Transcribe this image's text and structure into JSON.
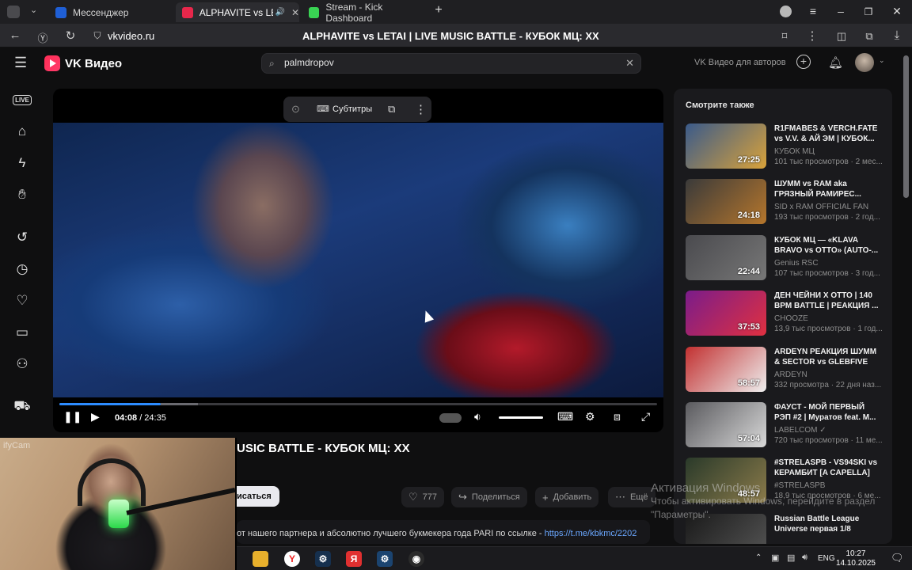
{
  "tabs": [
    {
      "label": "Мессенджер",
      "color": "#1f5fd6"
    },
    {
      "label": "ALPHAVITE vs LETA",
      "color": "#e8274b",
      "active": true
    },
    {
      "label": "Stream - Kick Dashboard",
      "color": "#39d353"
    }
  ],
  "address": {
    "url": "vkvideo.ru",
    "title": "ALPHAVITE vs LETAI | LIVE MUSIC BATTLE - КУБОК МЦ: XX"
  },
  "header": {
    "logo": "VK Видео",
    "search_value": "palmdropov",
    "authors_link": "VK Видео для авторов"
  },
  "rail_icons": [
    "live-icon",
    "home-icon",
    "shorts-icon",
    "hand-icon",
    "history-icon",
    "clock-icon",
    "heart-icon",
    "tv-icon",
    "subscriptions-icon",
    "cart-icon"
  ],
  "rail_live_label": "LIVE",
  "player": {
    "subtitles_label": "Субтитры",
    "time_current": "04:08",
    "time_total": " / 24:35",
    "progress": 0.169,
    "buffered": 0.232,
    "volume": 1.0
  },
  "video": {
    "title": "USIC BATTLE - КУБОК МЦ: XX",
    "subscribe_label": "исаться",
    "likes": "777",
    "share_label": "Поделиться",
    "add_label": "Добавить",
    "more_label": "Ещё",
    "description": "от нашего партнера и абсолютно лучшего букмекера года PARI по ссылке - ",
    "description_link": "https://t.me/kbkmc/2202"
  },
  "related": {
    "heading": "Смотрите также",
    "items": [
      {
        "title": "R1FMABES & VERCH.FATE vs V.V. & АЙ ЭМ | КУБОК...",
        "channel": "КУБОК МЦ",
        "meta": "101 тыс просмотров · 2 мес...",
        "duration": "27:25",
        "c1": "#3a5a8a",
        "c2": "#d9a23a"
      },
      {
        "title": "ШУММ vs RAM aka ГРЯЗНЫЙ РАМИРЕС...",
        "channel": "SID x RAM OFFICIAL FAN",
        "meta": "193 тыс просмотров · 2 год...",
        "duration": "24:18",
        "c1": "#3a3a3a",
        "c2": "#b5762c"
      },
      {
        "title": "КУБОК МЦ — «KLAVA BRAVO vs OTTO» (AUTO-...",
        "channel": "Genius RSC",
        "meta": "107 тыс просмотров · 3 год...",
        "duration": "22:44",
        "c1": "#4a4a4e",
        "c2": "#777"
      },
      {
        "title": "ДЕН ЧЕЙНИ X ОТТО | 140 BPM BATTLE | РЕАКЦИЯ ...",
        "channel": "CHOOZE",
        "meta": "13,9 тыс просмотров · 1 год...",
        "duration": "37:53",
        "c1": "#7a1c8a",
        "c2": "#e03040"
      },
      {
        "title": "ARDEYN РЕАКЦИЯ ШУММ & SECTOR vs GLEBFIVE &...",
        "channel": "ARDEYN",
        "meta": "332 просмотра · 22 дня наз...",
        "duration": "58:57",
        "c1": "#c23030",
        "c2": "#eeeeee"
      },
      {
        "title": "ФАУСТ - МОЙ ПЕРВЫЙ РЭП #2 | Муратов feat. M...",
        "channel": "LABELCOM ✓",
        "meta": "720 тыс просмотров · 11 ме...",
        "duration": "57:04",
        "c1": "#5a5a5e",
        "c2": "#d8d8d8"
      },
      {
        "title": "#STRELASPB - VS94SKI vs КЕРАМБИТ [A CAPELLA]",
        "channel": "#STRELASPB",
        "meta": "18,9 тыс просмотров · 6 ме...",
        "duration": "48:57",
        "c1": "#2a3a2a",
        "c2": "#8a7a4a"
      },
      {
        "title": "Russian Battle League Universe первая 1/8",
        "channel": "",
        "meta": "",
        "duration": "",
        "c1": "#1a1a1a",
        "c2": "#555"
      }
    ]
  },
  "webcam_tag": "ifyCam",
  "watermark": {
    "line1": "Активация Windows",
    "line2": "Чтобы активировать Windows, перейдите в раздел",
    "line3": "\"Параметры\"."
  },
  "taskbar": {
    "lang": "ENG",
    "time": "10:27",
    "date": "14.10.2025"
  }
}
